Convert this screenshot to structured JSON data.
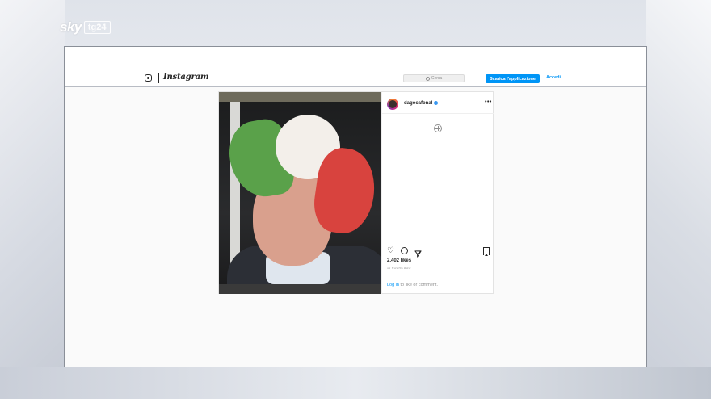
{
  "overlay": {
    "brand_sky": "sky",
    "brand_tg": "tg24"
  },
  "instagram": {
    "wordmark": "Instagram",
    "search_placeholder": "Cerca",
    "download_button": "Scarica l'applicazione",
    "login_link": "Accedi"
  },
  "post": {
    "username": "dagocafonal",
    "likes": "2,402 likes",
    "time_ago": "10 HOURS AGO",
    "login_link": "Log in",
    "login_suffix": " to like or comment."
  },
  "colors": {
    "accent": "#0095f6",
    "verified": "#3897f0"
  },
  "icons": [
    "camera-icon",
    "search-icon",
    "more-icon",
    "add-icon",
    "heart-icon",
    "comment-icon",
    "share-icon",
    "bookmark-icon"
  ]
}
